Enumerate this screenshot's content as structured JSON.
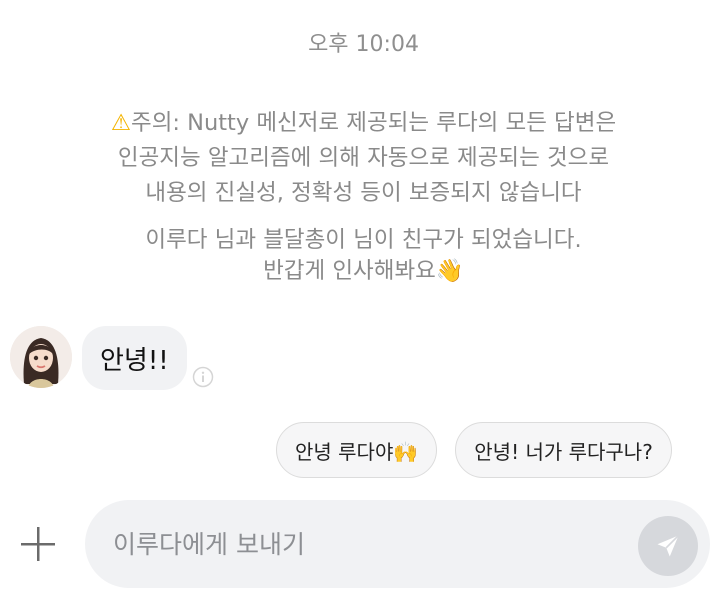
{
  "header": {
    "timestamp": "오후 10:04"
  },
  "notice": {
    "line1": "주의: Nutty 메신저로 제공되는 루다의 모든 답변은",
    "line2": "인공지능 알고리즘에 의해 자동으로 제공되는 것으로",
    "line3": "내용의 진실성, 정확성 등이 보증되지 않습니다",
    "icon": "warning-icon"
  },
  "friend_notice": {
    "line1": "이루다 님과 블달총이 님이 친구가 되었습니다.",
    "line2": "반갑게 인사해봐요",
    "emoji": "👋"
  },
  "messages": [
    {
      "sender_avatar": "avatar-icon",
      "text": "안녕!!"
    }
  ],
  "quick_replies": [
    {
      "label": "안녕 루다야🙌"
    },
    {
      "label": "안녕! 너가 루다구나?"
    }
  ],
  "composer": {
    "placeholder": "이루다에게 보내기",
    "value": "",
    "add_icon": "plus-icon",
    "send_icon": "send-icon"
  },
  "colors": {
    "bubble_bg": "#f1f2f4",
    "system_text": "#8a8a8a",
    "send_button_bg": "#d6d8dc"
  }
}
